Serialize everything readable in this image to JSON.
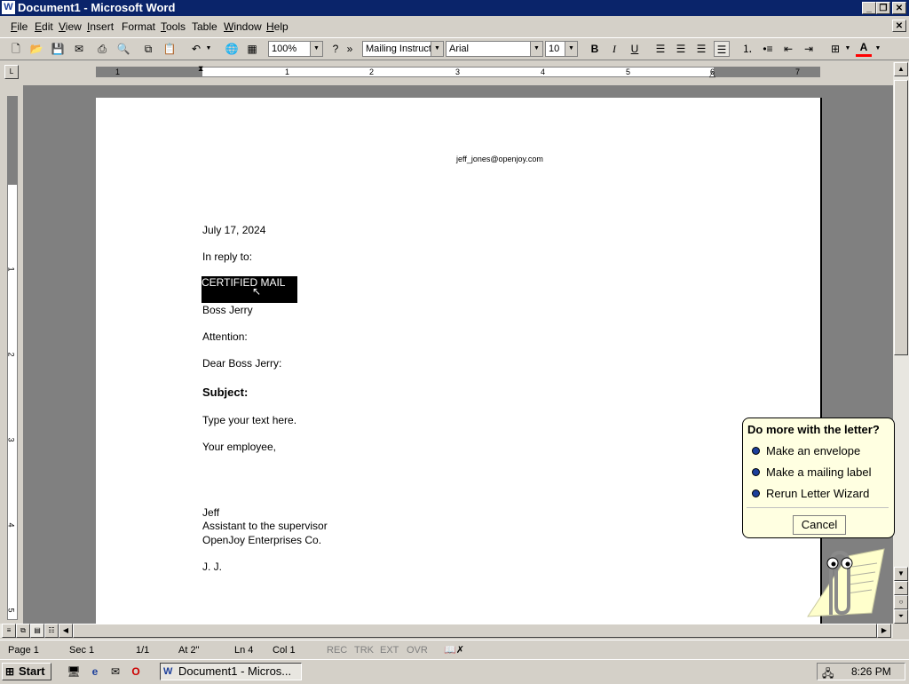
{
  "window": {
    "title": "Document1 - Microsoft Word",
    "app_icon": "W"
  },
  "menu": [
    {
      "label": "File",
      "key": "F",
      "rest": "ile"
    },
    {
      "label": "Edit",
      "key": "E",
      "rest": "dit"
    },
    {
      "label": "View",
      "key": "V",
      "rest": "iew"
    },
    {
      "label": "Insert",
      "key": "I",
      "rest": "nsert"
    },
    {
      "label": "Format",
      "key": "F",
      "rest": "ormat",
      "under_second": true
    },
    {
      "label": "Tools",
      "key": "T",
      "rest": "ools"
    },
    {
      "label": "Table",
      "key": "T",
      "rest": "able",
      "under_second": true
    },
    {
      "label": "Window",
      "key": "W",
      "rest": "indow"
    },
    {
      "label": "Help",
      "key": "H",
      "rest": "elp"
    }
  ],
  "toolbar": {
    "zoom": "100%",
    "style": "Mailing Instruct",
    "font": "Arial",
    "size": "10",
    "bold": "B",
    "italic": "I",
    "underline": "U",
    "font_color_label": "A"
  },
  "ruler": {
    "numbers": [
      "1",
      "1",
      "2",
      "3",
      "4",
      "5",
      "6",
      "7"
    ],
    "tab_label": "L"
  },
  "vruler": {
    "numbers": [
      "1",
      "1",
      "2",
      "3",
      "4",
      "5"
    ]
  },
  "document": {
    "email": "jeff_jones@openjoy.com",
    "date": "July 17, 2024",
    "reply": "In reply to:",
    "certified": "CERTIFIED MAIL",
    "recipient": "Boss Jerry",
    "attention": "Attention:",
    "salutation": "Dear Boss Jerry:",
    "subject": "Subject:",
    "body": "Type your text here.",
    "closing": "Your employee,",
    "sig_name": "Jeff",
    "sig_title": "Assistant to the supervisor",
    "sig_company": "OpenJoy Enterprises Co.",
    "initials": "J. J."
  },
  "balloon": {
    "title": "Do more with the letter?",
    "options": [
      "Make an envelope",
      "Make a mailing label",
      "Rerun Letter Wizard"
    ],
    "cancel": "Cancel"
  },
  "status": {
    "page": "Page 1",
    "sec": "Sec 1",
    "pages": "1/1",
    "at": "At 2\"",
    "ln": "Ln 4",
    "col": "Col 1",
    "rec": "REC",
    "trk": "TRK",
    "ext": "EXT",
    "ovr": "OVR"
  },
  "taskbar": {
    "start": "Start",
    "task": "Document1 - Micros...",
    "time": "8:26 PM"
  },
  "colors": {
    "titlebar": "#0a246a",
    "selection": "#000000",
    "balloon": "#ffffe1",
    "font_color": "#ff0000"
  }
}
